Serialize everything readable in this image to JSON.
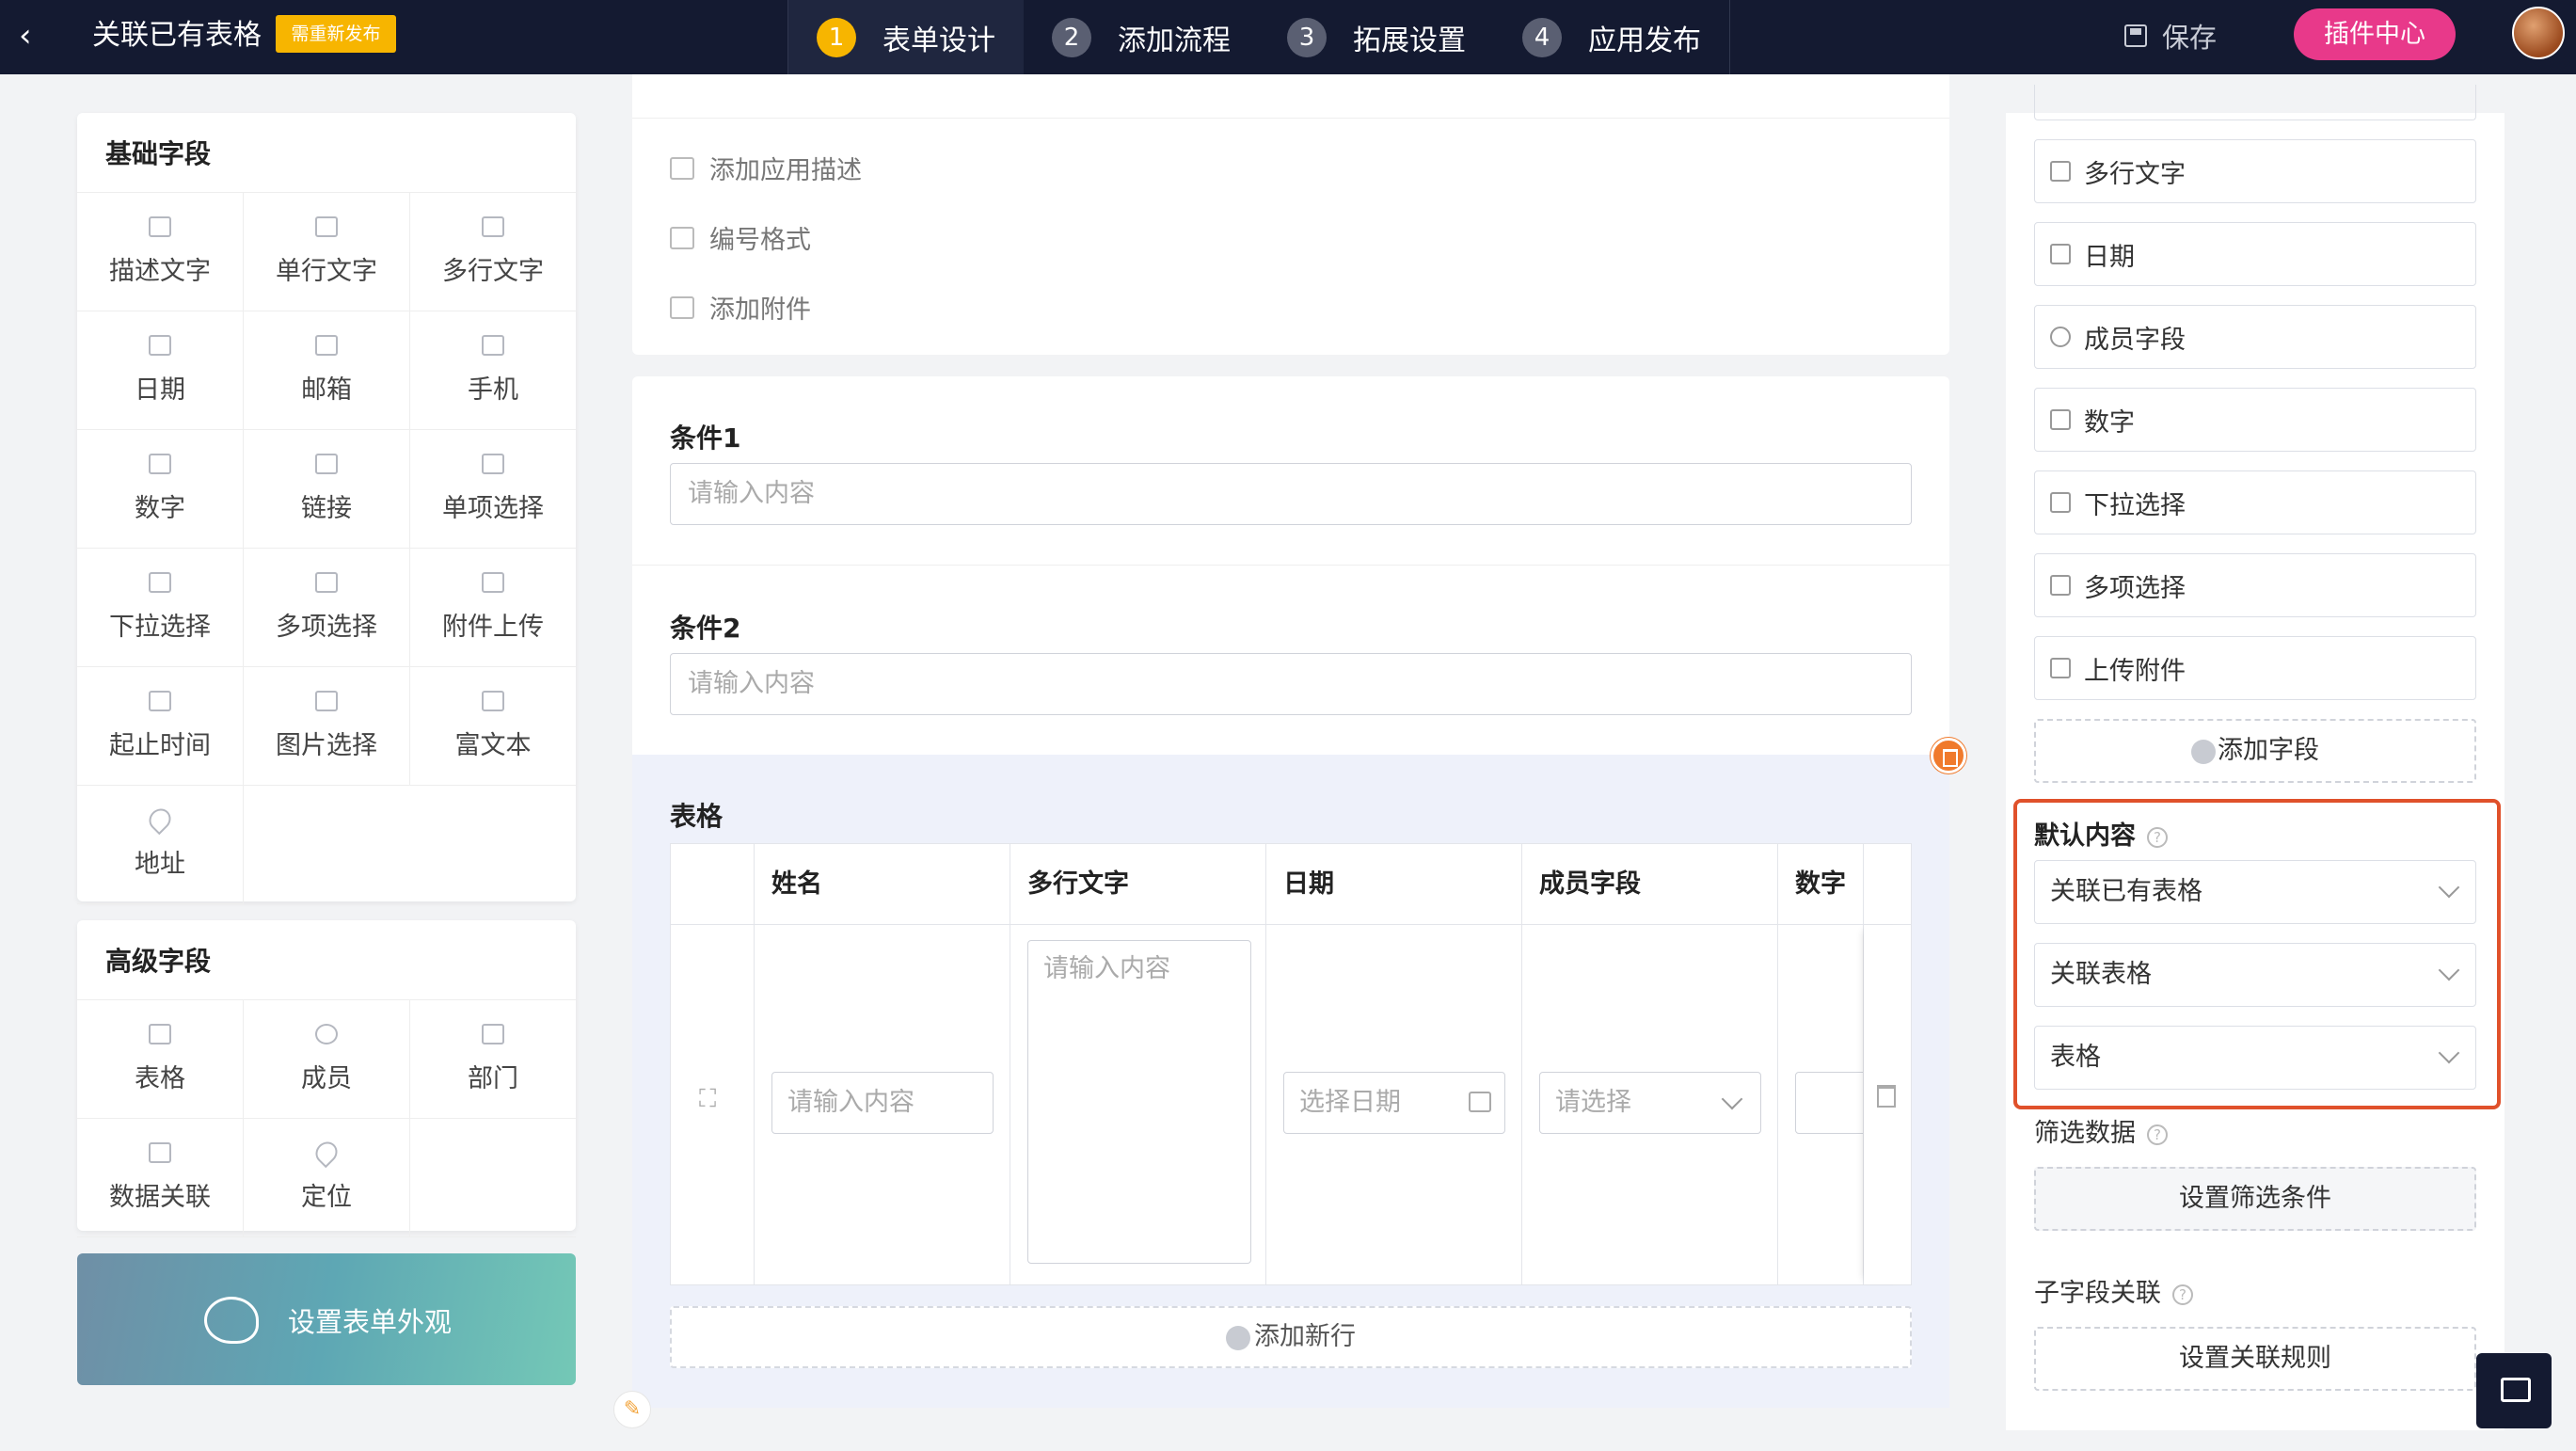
{
  "topbar": {
    "back_icon": "chevron-left-icon",
    "title": "关联已有表格",
    "badge": "需重新发布",
    "steps": [
      {
        "num": "1",
        "label": "表单设计"
      },
      {
        "num": "2",
        "label": "添加流程"
      },
      {
        "num": "3",
        "label": "拓展设置"
      },
      {
        "num": "4",
        "label": "应用发布"
      }
    ],
    "active_step": 1,
    "save_label": "保存",
    "plugin_label": "插件中心"
  },
  "basic_fields": {
    "title": "基础字段",
    "items": [
      "描述文字",
      "单行文字",
      "多行文字",
      "日期",
      "邮箱",
      "手机",
      "数字",
      "链接",
      "单项选择",
      "下拉选择",
      "多项选择",
      "附件上传",
      "起止时间",
      "图片选择",
      "富文本",
      "地址"
    ]
  },
  "advanced_fields": {
    "title": "高级字段",
    "items": [
      "表格",
      "成员",
      "部门",
      "数据关联",
      "定位"
    ]
  },
  "appearance_label": "设置表单外观",
  "middle": {
    "top_rows": [
      "添加应用描述",
      "编号格式",
      "添加附件"
    ],
    "cond1": {
      "label": "条件1",
      "placeholder": "请输入内容"
    },
    "cond2": {
      "label": "条件2",
      "placeholder": "请输入内容"
    },
    "table": {
      "label": "表格",
      "headers": [
        "姓名",
        "多行文字",
        "日期",
        "成员字段",
        "数字"
      ],
      "cells": {
        "name_placeholder": "请输入内容",
        "text_placeholder": "请输入内容",
        "date_placeholder": "选择日期",
        "member_placeholder": "请选择"
      },
      "add_row": "添加新行"
    }
  },
  "right": {
    "fields": [
      "多行文字",
      "日期",
      "成员字段",
      "数字",
      "下拉选择",
      "多项选择",
      "上传附件"
    ],
    "add_field": "添加字段",
    "default_content": {
      "label": "默认内容",
      "selects": [
        "关联已有表格",
        "关联表格",
        "表格"
      ]
    },
    "filter": {
      "label": "筛选数据",
      "button": "设置筛选条件"
    },
    "sub_link": {
      "label": "子字段关联",
      "button": "设置关联规则"
    }
  },
  "colors": {
    "topbar": "#141a31",
    "accent_yellow": "#f7b500",
    "plugin_pink": "#e8398a",
    "highlight": "#e0512b"
  }
}
